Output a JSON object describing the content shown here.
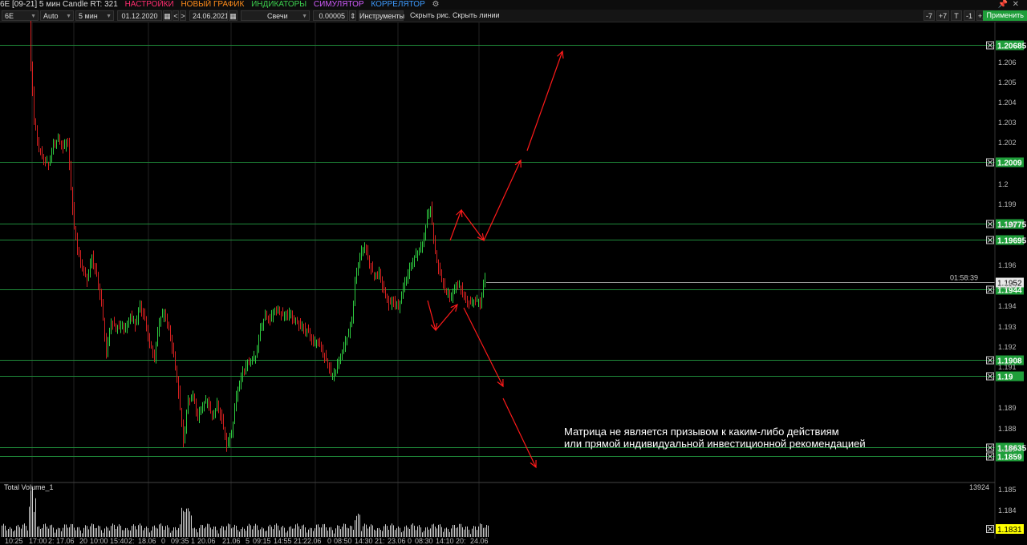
{
  "titlebar": {
    "title": "6E [09-21] 5 мин Candle RT: 321",
    "menu": [
      "НАСТРОЙКИ",
      "НОВЫЙ ГРАФИК",
      "ИНДИКАТОРЫ",
      "СИМУЛЯТОР",
      "КОРРЕЛЯТОР"
    ],
    "settings_icon": "gear-icon",
    "pin_icon": "pin-icon",
    "close_icon": "close-icon"
  },
  "toolbar": {
    "symbol": "6E",
    "scale": "Auto",
    "timeframe": "5 мин",
    "date_from": "01.12.2020",
    "date_to": "24.06.2021",
    "chart_type": "Свечи",
    "tick_size": "0.00005",
    "instruments": "Инструменты",
    "hide_drawings": "Скрыть рис.",
    "hide_lines": "Скрыть линии",
    "zoom_buttons": [
      "-7",
      "+7",
      "T",
      "-1",
      "+1"
    ],
    "apply": "Применить"
  },
  "colors": {
    "level_line": "#1f8a3a",
    "price_label": "#1f9e3a",
    "current_label": "#e8e8e8",
    "arrow": "#ff1a1a",
    "candle_up": "#2ecc40",
    "candle_down": "#d62020",
    "volume_label": "#ffff00"
  },
  "price_axis": {
    "ticks": [
      "1.206",
      "1.205",
      "1.204",
      "1.203",
      "1.202",
      "1.2",
      "1.199",
      "1.198",
      "1.196",
      "1.195",
      "1.194",
      "1.193",
      "1.192",
      "1.191",
      "1.189",
      "1.188",
      "1.187",
      "1.185",
      "1.184",
      "1.183"
    ],
    "levels": [
      {
        "label": "1.20685",
        "value": 1.20685
      },
      {
        "label": "1.2009",
        "value": 1.2009
      },
      {
        "label": "1.19775",
        "value": 1.19775
      },
      {
        "label": "1.19695",
        "value": 1.19695
      },
      {
        "label": "1.1944",
        "value": 1.1944
      },
      {
        "label": "1.1908",
        "value": 1.1908
      },
      {
        "label": "1.19",
        "value": 1.19
      },
      {
        "label": "1.18635",
        "value": 1.18635
      },
      {
        "label": "1.1859",
        "value": 1.1859
      }
    ],
    "current_price": "1.1952",
    "countdown": "01:58:39"
  },
  "time_axis": [
    "10:25",
    "17:00",
    "2:",
    "17.06",
    "20",
    "10:00",
    "15:40",
    "2:",
    "18.06",
    "0",
    "09:35",
    "1",
    "20.06",
    "21.06",
    "5",
    "09:15",
    "14:55",
    "21:",
    "22.06",
    "0",
    "08:50",
    "14:30",
    "21:",
    "23.06",
    "0",
    "08:30",
    "14:10",
    "20:",
    "24.06"
  ],
  "volume_panel": {
    "title": "Total Volume_1",
    "max_value": "13924",
    "last_label": "1.1831"
  },
  "disclaimer": {
    "line1": "Матрица не является призывом к каким-либо действиям",
    "line2": "или прямой индивидуальной инвестиционной рекомендацией"
  }
}
